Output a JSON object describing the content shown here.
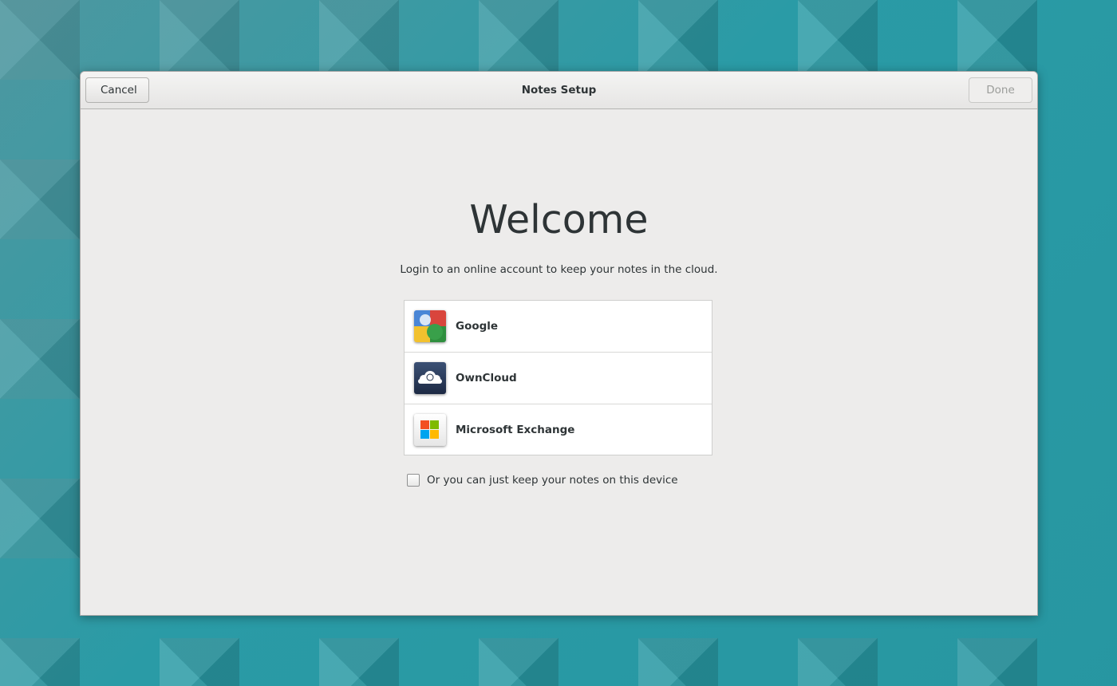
{
  "window": {
    "title": "Notes Setup",
    "cancel_label": "Cancel",
    "done_label": "Done"
  },
  "main": {
    "heading": "Welcome",
    "subtitle": "Login to an online account to keep your notes in the cloud.",
    "accounts": [
      {
        "label": "Google",
        "icon": "google-icon"
      },
      {
        "label": "OwnCloud",
        "icon": "owncloud-icon"
      },
      {
        "label": "Microsoft Exchange",
        "icon": "microsoft-exchange-icon"
      }
    ],
    "local_option": {
      "label": "Or you can just keep your notes on this device",
      "checked": false
    }
  },
  "colors": {
    "window_bg": "#edeceb",
    "text": "#2e3436",
    "disabled_text": "#9b9d9a",
    "desktop": "#2a9aa5"
  }
}
